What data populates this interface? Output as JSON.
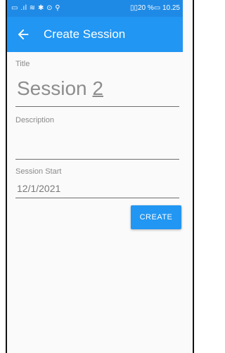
{
  "statusbar": {
    "left_icons": "▭ .ıl ≋ ✱ ⊙ ⚲",
    "right_text": "▯▯20 %▭ 10.25"
  },
  "appbar": {
    "title": "Create Session",
    "back_icon": "arrow-left-icon"
  },
  "form": {
    "title_label": "Title",
    "title_value_prefix": "Session ",
    "title_value_cursor": "2",
    "description_label": "Description",
    "description_value": "",
    "start_label": "Session Start",
    "start_value": "12/1/2021"
  },
  "actions": {
    "create_label": "CREATE"
  },
  "colors": {
    "primary": "#2196f3",
    "statusbar": "#1f8ae6",
    "background": "#fafafa"
  }
}
